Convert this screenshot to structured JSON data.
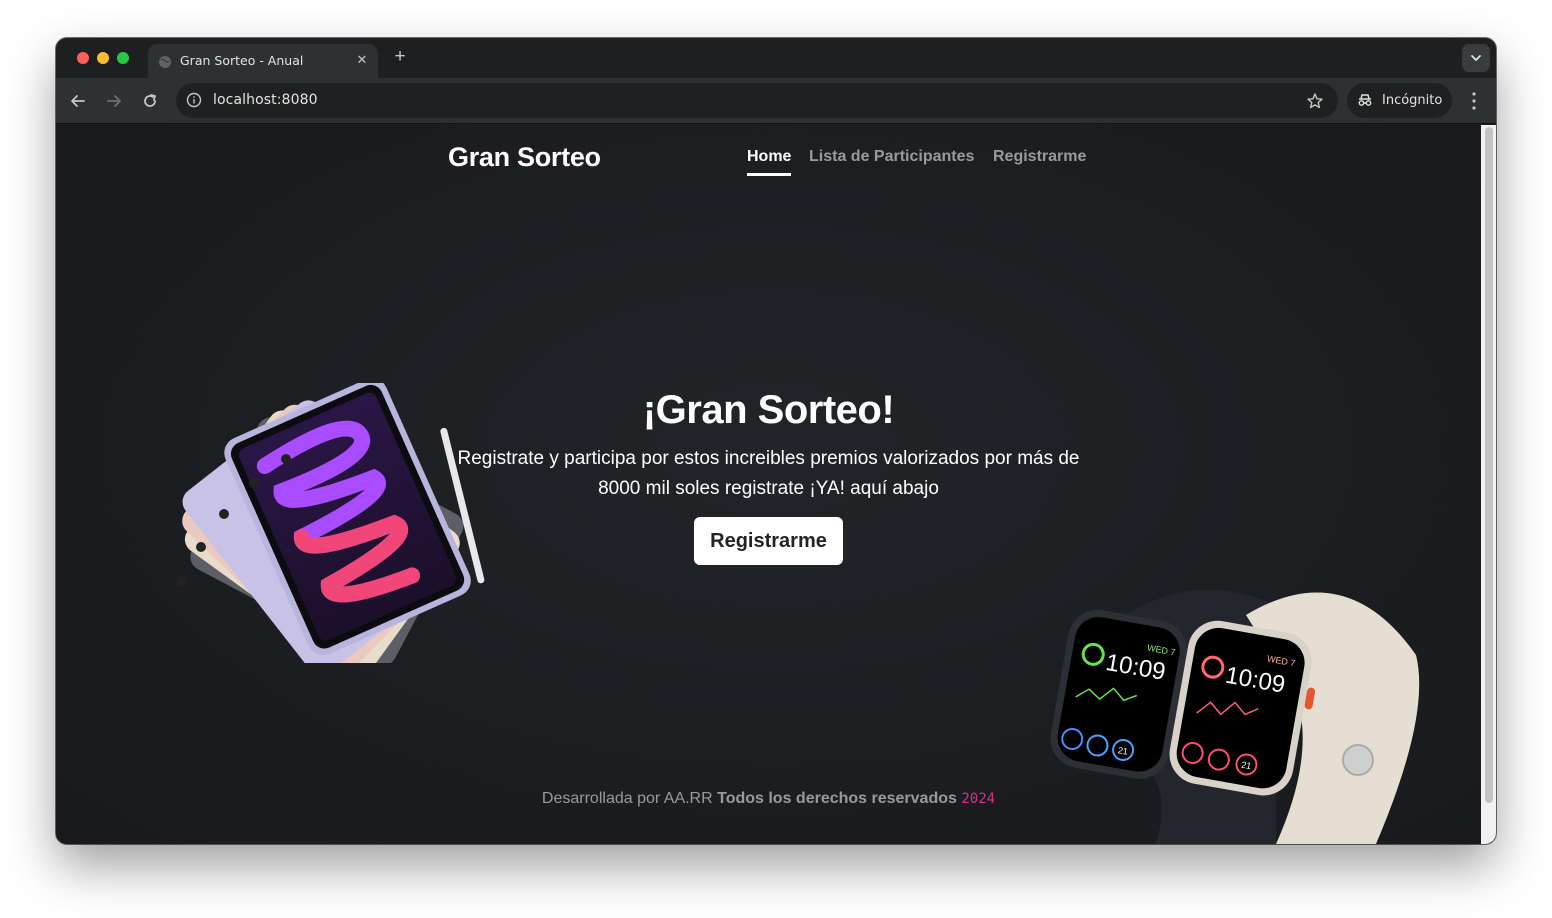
{
  "browser": {
    "tab_title": "Gran Sorteo - Anual",
    "url": "localhost:8080",
    "profile_label": "Incógnito"
  },
  "navbar": {
    "brand": "Gran Sorteo",
    "links": [
      {
        "label": "Home",
        "active": true
      },
      {
        "label": "Lista de Participantes",
        "active": false
      },
      {
        "label": "Registrarme",
        "active": false
      }
    ]
  },
  "hero": {
    "title": "¡Gran Sorteo!",
    "description": "Registrate y participa por estos increibles premios valorizados por más de 8000 mil soles registrate ¡YA! aquí abajo",
    "cta_label": "Registrarme"
  },
  "footer": {
    "prefix": "Desarrollada por AA.RR ",
    "rights": "Todos los derechos reservados",
    "year": "2024"
  },
  "watches": {
    "left_day": "WED 7",
    "left_time": "10:09",
    "right_day": "WED 7",
    "right_time": "10:09",
    "complication_date": "21"
  },
  "colors": {
    "page_bg": "#1b1d21",
    "accent_year": "#d63384",
    "nav_muted": "rgba(255,255,255,0.55)"
  }
}
